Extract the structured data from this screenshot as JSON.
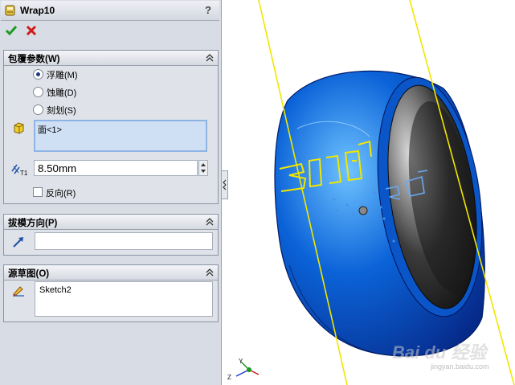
{
  "window": {
    "title": "Wrap10",
    "help_label": "?"
  },
  "groups": {
    "wrap_params": {
      "title": "包覆参数(W)",
      "options": [
        {
          "label": "浮雕(M)",
          "selected": true
        },
        {
          "label": "蚀雕(D)",
          "selected": false
        },
        {
          "label": "刻划(S)",
          "selected": false
        }
      ],
      "face_selection": "面<1>",
      "distance_value": "8.50mm",
      "reverse_label": "反向(R)",
      "reverse_checked": false
    },
    "pull_direction": {
      "title": "拔模方向(P)",
      "value": ""
    },
    "source_sketch": {
      "title": "源草图(O)",
      "value": "Sketch2"
    }
  },
  "watermark": {
    "site": "jingyan.baidu.com",
    "logo_text": "Bai du 经验"
  },
  "colors": {
    "accent_blue": "#1a6fe0",
    "sketch_yellow": "#f2e600",
    "panel_bg": "#d8dce4"
  }
}
